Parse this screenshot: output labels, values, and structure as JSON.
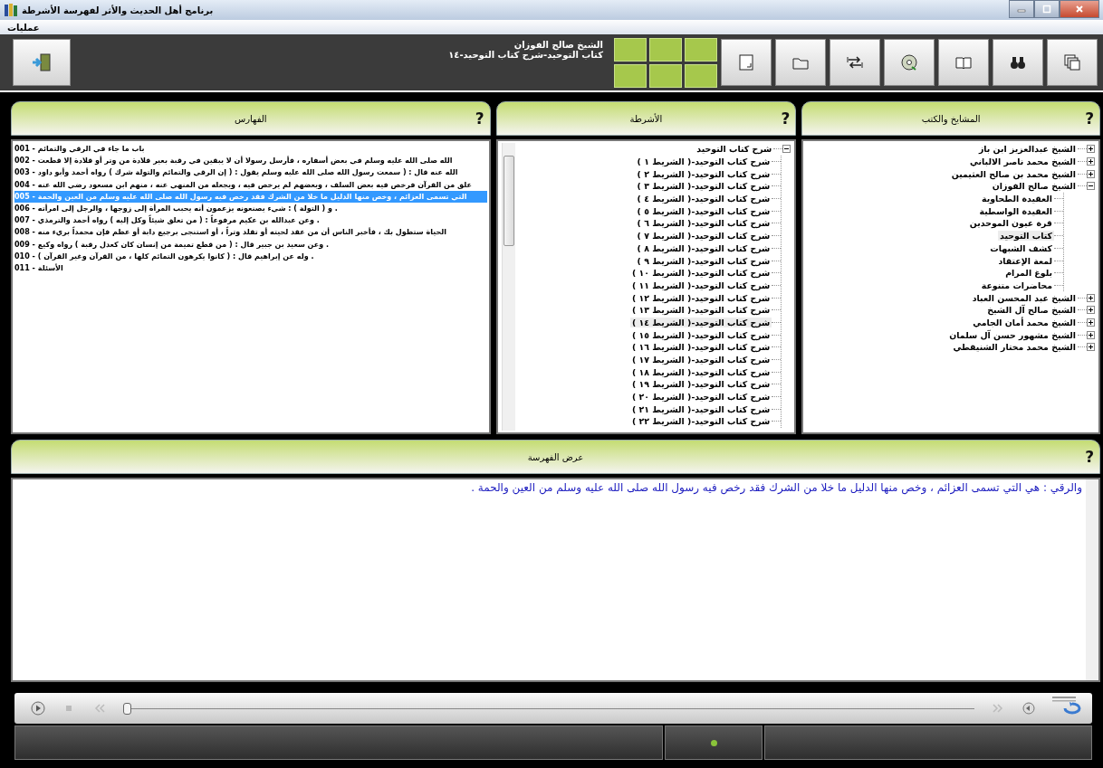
{
  "window": {
    "title": "برنامج أهل الحديث والأثر لفهرسة الأشرطة"
  },
  "menu": [
    {
      "label": "عمليات"
    }
  ],
  "toolbar": {
    "heading": "الشيخ صالح الفوزان",
    "subheading": "كتاب التوحيد-شرح كتاب التوحيد-١٤"
  },
  "indexes": {
    "title": "الفهارس",
    "help": "?",
    "items": [
      {
        "number": "001 -",
        "text": "باب ما جاء في الرقي والتمائم",
        "selected": false
      },
      {
        "number": "002 -",
        "text": "الله صلى الله عليه وسلم في بعض أسفاره ، فأرسل رسولا أن لا يبقين في رقبة بعير قلادة من وتر أو قلادة إلا قطعت",
        "selected": false
      },
      {
        "number": "003 -",
        "text": "الله عنه قال : ( سمعت رسول الله صلى الله عليه وسلم يقول : ( إن الرقي والتمائم والتولة شرك ) رواه أحمد وأبو داود",
        "selected": false
      },
      {
        "number": "004 -",
        "text": "علق من القرآن فرخص فيه بعض السلف ، وبعضهم لم يرخص فيه ، ويجعله من المنهي عنه ، منهم ابن مسعود رضي الله عنه",
        "selected": false
      },
      {
        "number": "005 -",
        "text": "التي تسمى العزائم ، وخص منها الدليل ما خلا من الشرك فقد رخص فيه رسول الله صلى الله عليه وسلم من العين والحمة",
        "selected": true
      },
      {
        "number": "006 -",
        "text": ". و ( التولة ) : شيء يصنعونه يزعمون أنه يحبب المرأة إلى زوجها ، والرجل إلى امرأته",
        "selected": false
      },
      {
        "number": "007 -",
        "text": ". وعن عبدالله بن عكيم مرفوعاً : ( من تعلق شيئاً وكل إليه ) رواه أحمد والترمذي",
        "selected": false
      },
      {
        "number": "008 -",
        "text": "الحياة ستطول بك ، فأخبر الناس أن من عقد لحيته أو تقلد وتراً ، أو استنجى برجيع دابة أو عظم فإن محمداً بريء منه",
        "selected": false
      },
      {
        "number": "009 -",
        "text": ". وعن سعيد بن جبير قال : ( من قطع تميمة من إنسان كان كعدل رقبة ) رواه وكيع",
        "selected": false
      },
      {
        "number": "010 -",
        "text": ". وله عن إبراهيم قال : ( كانوا يكرهون التمائم كلها ، من القرآن وغير القرآن )",
        "selected": false
      },
      {
        "number": "011 -",
        "text": "الأسئلة",
        "selected": false
      }
    ]
  },
  "tapes": {
    "title": "الأشرطة",
    "help": "?",
    "tree": [
      {
        "label": "شرح كتاب التوحيد",
        "expanded": true,
        "selected": false,
        "children": [
          {
            "label": "شرح كتاب التوحيد-( الشريط ١ )",
            "selected": false
          },
          {
            "label": "شرح كتاب التوحيد-( الشريط ٢ )",
            "selected": false
          },
          {
            "label": "شرح كتاب التوحيد-( الشريط ٣ )",
            "selected": false
          },
          {
            "label": "شرح كتاب التوحيد-( الشريط ٤ )",
            "selected": false
          },
          {
            "label": "شرح كتاب التوحيد-( الشريط ٥ )",
            "selected": false
          },
          {
            "label": "شرح كتاب التوحيد-( الشريط ٦ )",
            "selected": false
          },
          {
            "label": "شرح كتاب التوحيد-( الشريط ٧ )",
            "selected": false
          },
          {
            "label": "شرح كتاب التوحيد-( الشريط ٨ )",
            "selected": false
          },
          {
            "label": "شرح كتاب التوحيد-( الشريط ٩ )",
            "selected": false
          },
          {
            "label": "شرح كتاب التوحيد-( الشريط ١٠ )",
            "selected": false
          },
          {
            "label": "شرح كتاب التوحيد-( الشريط ١١ )",
            "selected": false
          },
          {
            "label": "شرح كتاب التوحيد-( الشريط ١٢ )",
            "selected": false
          },
          {
            "label": "شرح كتاب التوحيد-( الشريط ١٣ )",
            "selected": false
          },
          {
            "label": "شرح كتاب التوحيد-( الشريط ١٤ )",
            "selected": true
          },
          {
            "label": "شرح كتاب التوحيد-( الشريط ١٥ )",
            "selected": false
          },
          {
            "label": "شرح كتاب التوحيد-( الشريط ١٦ )",
            "selected": false
          },
          {
            "label": "شرح كتاب التوحيد-( الشريط ١٧ )",
            "selected": false
          },
          {
            "label": "شرح كتاب التوحيد-( الشريط ١٨ )",
            "selected": false
          },
          {
            "label": "شرح كتاب التوحيد-( الشريط ١٩ )",
            "selected": false
          },
          {
            "label": "شرح كتاب التوحيد-( الشريط ٢٠ )",
            "selected": false
          },
          {
            "label": "شرح كتاب التوحيد-( الشريط ٢١ )",
            "selected": false
          },
          {
            "label": "شرح كتاب التوحيد-( الشريط ٢٢ )",
            "selected": false
          }
        ]
      }
    ]
  },
  "scholars": {
    "title": "المشايخ والكتب",
    "help": "?",
    "tree": [
      {
        "label": "الشيخ عبدالعزيز ابن باز",
        "expanded": false,
        "selected": false
      },
      {
        "label": "الشيخ محمد ناصر الالباني",
        "expanded": false,
        "selected": false
      },
      {
        "label": "الشيخ محمد بن صالح العثيمين",
        "expanded": false,
        "selected": false
      },
      {
        "label": "الشيخ صالح الفوزان",
        "expanded": true,
        "selected": false,
        "children": [
          {
            "label": "العقيدة الطحاوية",
            "selected": false
          },
          {
            "label": "العقيدة الواسطية",
            "selected": false
          },
          {
            "label": "قرة عيون الموحدين",
            "selected": false
          },
          {
            "label": "كتاب التوحيد",
            "selected": true
          },
          {
            "label": "كشف الشبهات",
            "selected": false
          },
          {
            "label": "لمعة الإعتقاد",
            "selected": false
          },
          {
            "label": "بلوغ المرام",
            "selected": false
          },
          {
            "label": "محاضرات متنوعة",
            "selected": false
          }
        ]
      },
      {
        "label": "الشيخ عبد المحسن العباد",
        "expanded": false,
        "selected": false
      },
      {
        "label": "الشيخ صالح آل الشيخ",
        "expanded": false,
        "selected": false
      },
      {
        "label": "الشيخ محمد أمان الجامي",
        "expanded": false,
        "selected": false
      },
      {
        "label": "الشيخ مشهور حسن آل سلمان",
        "expanded": false,
        "selected": false
      },
      {
        "label": "الشيخ محمد مختار الشنيقطي",
        "expanded": false,
        "selected": false
      }
    ]
  },
  "preview": {
    "title": "عرض الفهرسة",
    "help": "?",
    "text": "والرقي : هي التي تسمى العزائم ، وخص منها الدليل ما خلا من الشرك فقد رخص فيه رسول الله صلى الله عليه وسلم من العين والحمة ."
  },
  "player": {
    "seek": {
      "level": 0
    }
  },
  "status_bar": {
    "indicator": {
      "on": true
    }
  }
}
